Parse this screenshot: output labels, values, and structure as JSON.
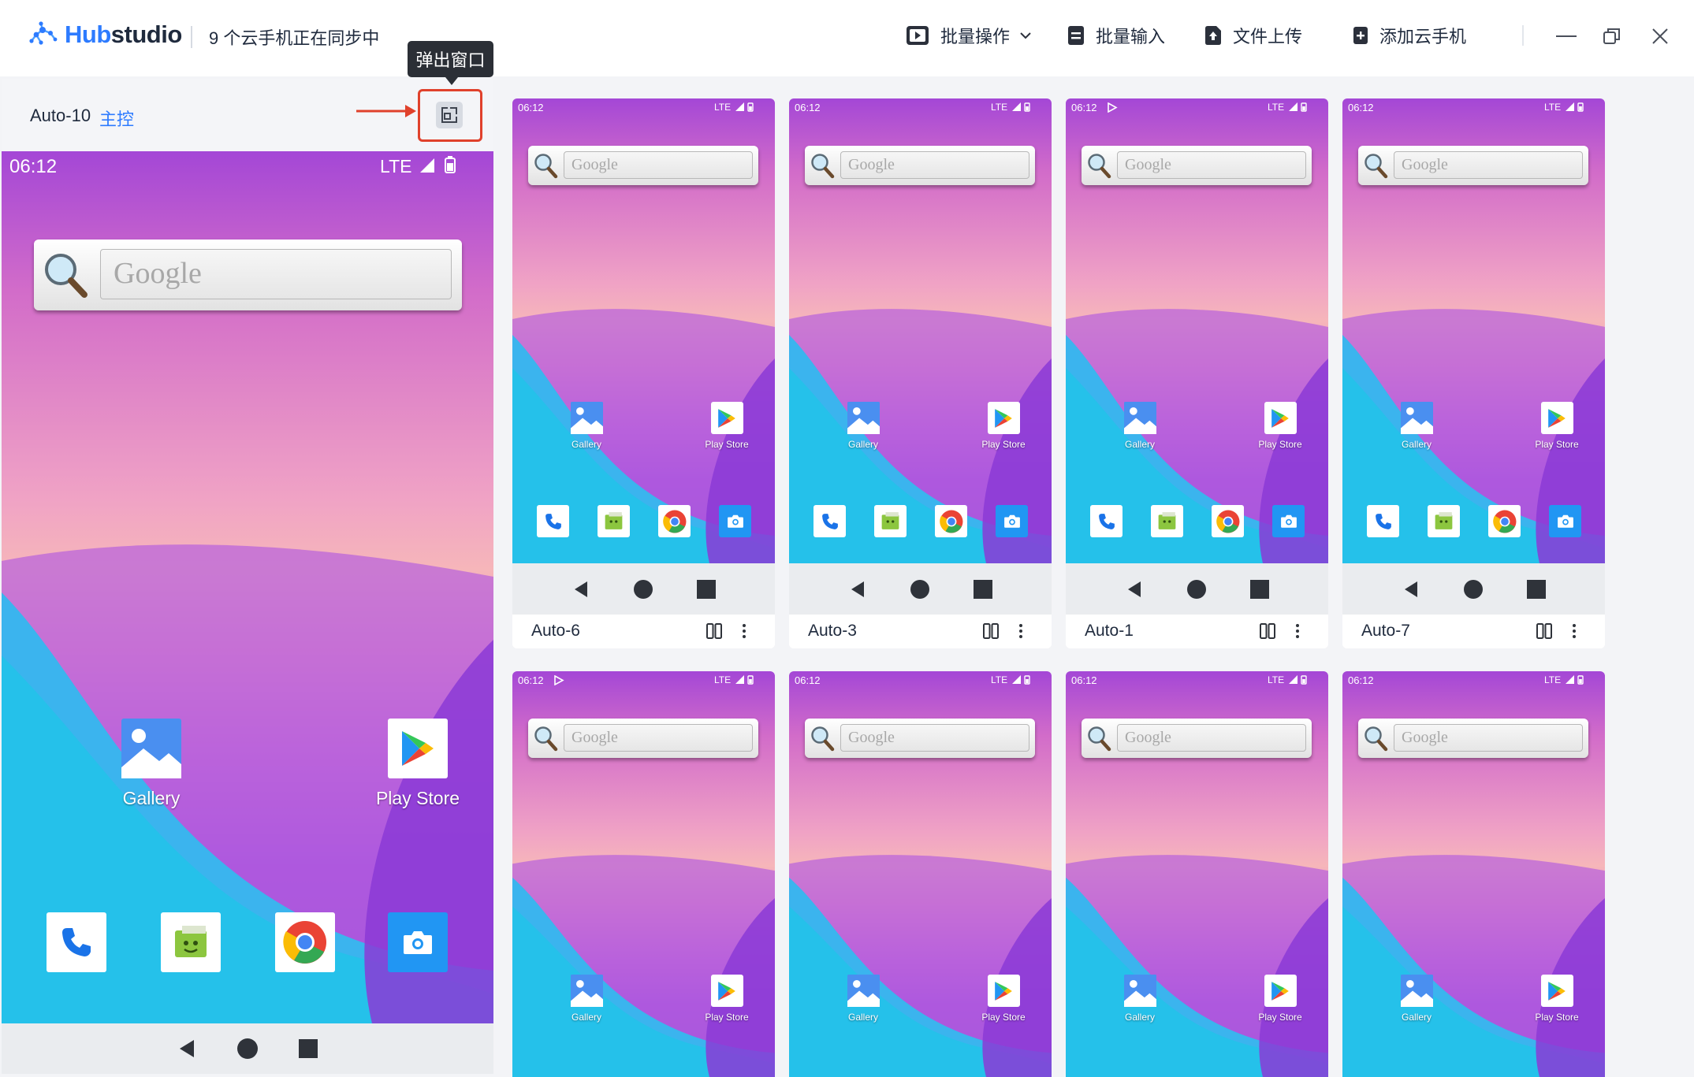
{
  "app": {
    "brand_hub": "Hub",
    "brand_studio": "studio",
    "sync_status": "9 个云手机正在同步中"
  },
  "toolbar": {
    "batch_ops": "批量操作",
    "batch_input": "批量输入",
    "file_upload": "文件上传",
    "add_cloud_phone": "添加云手机"
  },
  "master": {
    "device_name": "Auto-10",
    "role_tag": "主控",
    "popout_tooltip": "弹出窗口"
  },
  "phone": {
    "time": "06:12",
    "network": "LTE",
    "search_placeholder": "Google",
    "apps": [
      "Gallery",
      "Play Store"
    ]
  },
  "devices_row1": [
    "Auto-6",
    "Auto-3",
    "Auto-1",
    "Auto-7"
  ],
  "devices_row2_count": 4,
  "colors": {
    "accent": "#2d7bff",
    "highlight": "#e0412c"
  }
}
